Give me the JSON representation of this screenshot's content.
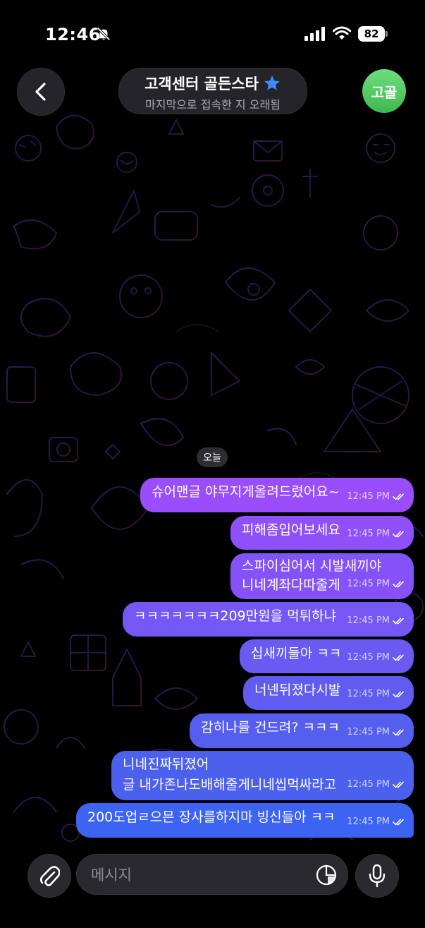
{
  "status_bar": {
    "time": "12:46",
    "battery": "82"
  },
  "header": {
    "title": "고객센터 골든스타",
    "subtitle": "마지막으로 접속한 지 오래됨",
    "avatar_initials": "고골"
  },
  "date_chip": "오늘",
  "messages": [
    {
      "text": "슈어맨글 야무지게올려드렸어요~",
      "time": "12:45 PM"
    },
    {
      "text": "피해좀입어보세요",
      "time": "12:45 PM"
    },
    {
      "text": "스파이심어서 시발새끼야\n니네계좌다따줄게",
      "time": "12:45 PM"
    },
    {
      "text": "ㅋㅋㅋㅋㅋㅋㅋ209만원을 먹튀하냐",
      "time": "12:45 PM"
    },
    {
      "text": "십새끼들아 ㅋㅋ",
      "time": "12:45 PM"
    },
    {
      "text": "너넨뒤졌다시발",
      "time": "12:45 PM"
    },
    {
      "text": "감히나를 건드려? ㅋㅋㅋ",
      "time": "12:45 PM"
    },
    {
      "text": "니네진짜뒤졌어\n글 내가존나도배해줄게니네씹먹싸라고",
      "time": "12:45 PM"
    },
    {
      "text": "200도업ㄹ으믄 장사를하지마 빙신들아 ㅋㅋ",
      "time": "12:45 PM"
    }
  ],
  "input": {
    "placeholder": "메시지"
  },
  "colors": {
    "bubble_top": "#9a4dfa",
    "bubble_bottom": "#3d63f2",
    "avatar_green": "#4fc65f",
    "star": "#3d8bff"
  },
  "icons": [
    "back-arrow-icon",
    "star-icon",
    "mute-bell-icon",
    "signal-icon",
    "wifi-icon",
    "paperclip-icon",
    "sticker-icon",
    "microphone-icon",
    "double-check-icon"
  ]
}
